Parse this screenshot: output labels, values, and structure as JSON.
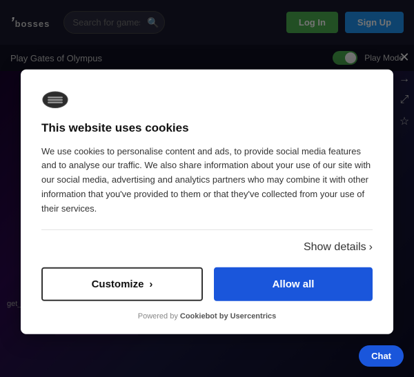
{
  "header": {
    "logo_text": "bosses",
    "search_placeholder": "Search for games",
    "login_label": "Log In",
    "signup_label": "Sign Up"
  },
  "sub_header": {
    "title": "Play Gates of Olympus",
    "play_mode_label": "Play Mode"
  },
  "side_icons": {
    "arrow_right": "→",
    "expand": "⤢",
    "star": "☆",
    "close": "✕"
  },
  "cookie_modal": {
    "title": "This website uses cookies",
    "body": "We use cookies to personalise content and ads, to provide social media features and to analyse our traffic. We also share information about your use of our site with our social media, advertising and analytics partners who may combine it with other information that you've provided to them or that they've collected from your use of their services.",
    "show_details_label": "Show details",
    "customize_label": "Customize",
    "allow_all_label": "Allow all",
    "powered_by_text": "Powered by",
    "powered_by_link": "Cookiebot by Usercentrics"
  },
  "footer": {
    "error_text": "get_game_link_system_error",
    "chat_label": "Chat"
  }
}
